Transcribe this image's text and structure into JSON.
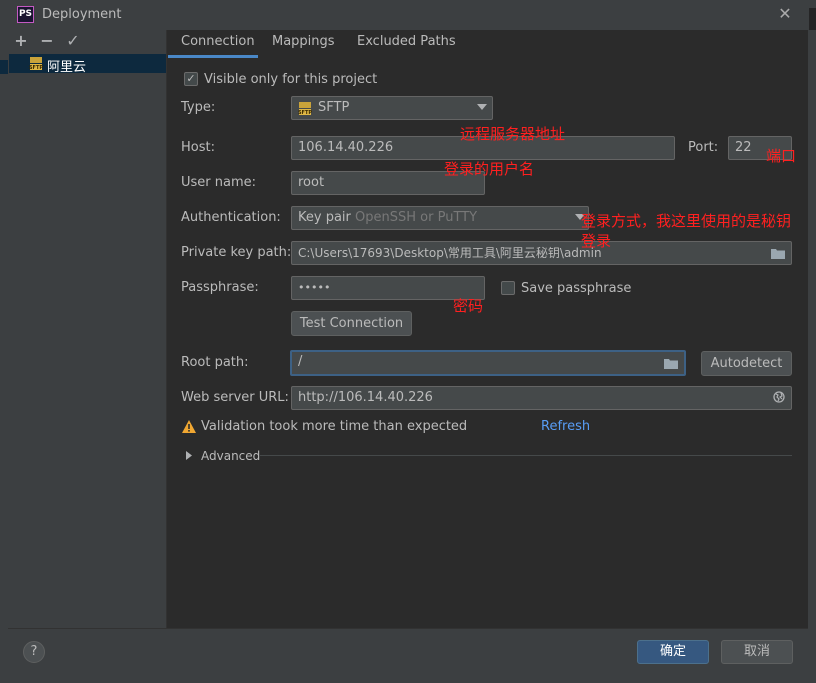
{
  "window": {
    "title": "Deployment",
    "logo_text": "PS"
  },
  "sidebar": {
    "add": "+",
    "remove": "−",
    "apply": "✓",
    "servers": [
      {
        "name": "阿里云",
        "icon": "sftp-icon"
      }
    ]
  },
  "tabs": [
    "Connection",
    "Mappings",
    "Excluded Paths"
  ],
  "form": {
    "visible_only_label": "Visible only for this project",
    "visible_only_checked": true,
    "type_label": "Type:",
    "type_value": "SFTP",
    "host_label": "Host:",
    "host_value": "106.14.40.226",
    "port_label": "Port:",
    "port_value": "22",
    "user_label": "User name:",
    "user_value": "root",
    "auth_label": "Authentication:",
    "auth_value": "Key pair",
    "auth_hint": "OpenSSH or PuTTY",
    "key_label": "Private key path:",
    "key_value": "C:\\Users\\17693\\Desktop\\常用工具\\阿里云秘钥\\admin",
    "pass_label": "Passphrase:",
    "pass_value": "•••••",
    "save_pass_label": "Save passphrase",
    "test_button": "Test Connection",
    "root_label": "Root path:",
    "root_value": "/",
    "autodetect_button": "Autodetect",
    "web_label": "Web server URL:",
    "web_value": "http://106.14.40.226",
    "validation_text": "Validation took more time than expected",
    "refresh_link": "Refresh",
    "advanced_label": "Advanced"
  },
  "annotations": {
    "host_note": "远程服务器地址",
    "port_note": "端口",
    "user_note": "登录的用户名",
    "auth_note_1": "登录方式，我这里使用的是秘钥",
    "auth_note_2": "登录",
    "pass_note": "密码"
  },
  "footer": {
    "help": "?",
    "ok_button": "确定",
    "cancel_button": "取消"
  },
  "colors": {
    "accent": "#4a88c7",
    "annotation": "#ff2020",
    "link": "#589df6",
    "warning": "#f0a732"
  }
}
